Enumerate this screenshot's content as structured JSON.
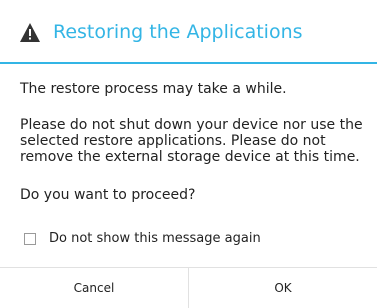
{
  "dialog": {
    "icon": "warning-triangle-icon",
    "title": "Restoring the Applications",
    "accent_color": "#33b5e5",
    "paragraphs": [
      "The restore process may take a while.",
      "Please do not shut down your device nor use the selected restore applications. Please do not remove the external storage device at this time.",
      "Do you want to proceed?"
    ],
    "checkbox": {
      "label": "Do not show this message again",
      "checked": false
    },
    "buttons": {
      "cancel": "Cancel",
      "ok": "OK"
    }
  }
}
